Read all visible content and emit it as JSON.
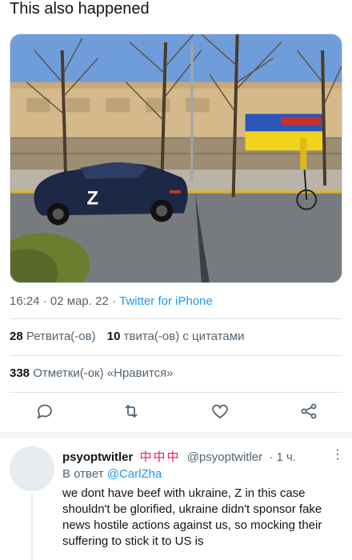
{
  "headline": "This also happened",
  "photo": {
    "alt_icon": "photo-car-with-z",
    "car_marking": "Z",
    "colors": {
      "sky": "#5f8fd4",
      "car": "#1d2746",
      "road": "#6f7275",
      "wall": "#d6b98a"
    }
  },
  "meta": {
    "time": "16:24",
    "date": "02 мар. 22",
    "separator": "·",
    "source": "Twitter for iPhone"
  },
  "stats": {
    "retweets_count": "28",
    "retweets_label": "Ретвита(-ов)",
    "quotes_count": "10",
    "quotes_label": "твита(-ов) с цитатами",
    "likes_count": "338",
    "likes_label": "Отметки(-ок) «Нравится»"
  },
  "actions": {
    "reply_icon": "reply-icon",
    "retweet_icon": "retweet-icon",
    "like_icon": "heart-icon",
    "share_icon": "share-icon"
  },
  "reply": {
    "name": "psyoptwitler",
    "flags": "中中中",
    "handle": "@psyoptwitler",
    "time": "· 1 ч.",
    "more": "⋮",
    "reply_prefix": "В ответ",
    "reply_to": "@CarlZha",
    "text": "we dont have beef with ukraine, Z in this case shouldn't be glorified, ukraine didn't sponsor fake news hostile actions against us, so mocking their suffering to stick it to US is"
  },
  "colors": {
    "accent": "#1d9bf0",
    "secondary_text": "#536471"
  }
}
